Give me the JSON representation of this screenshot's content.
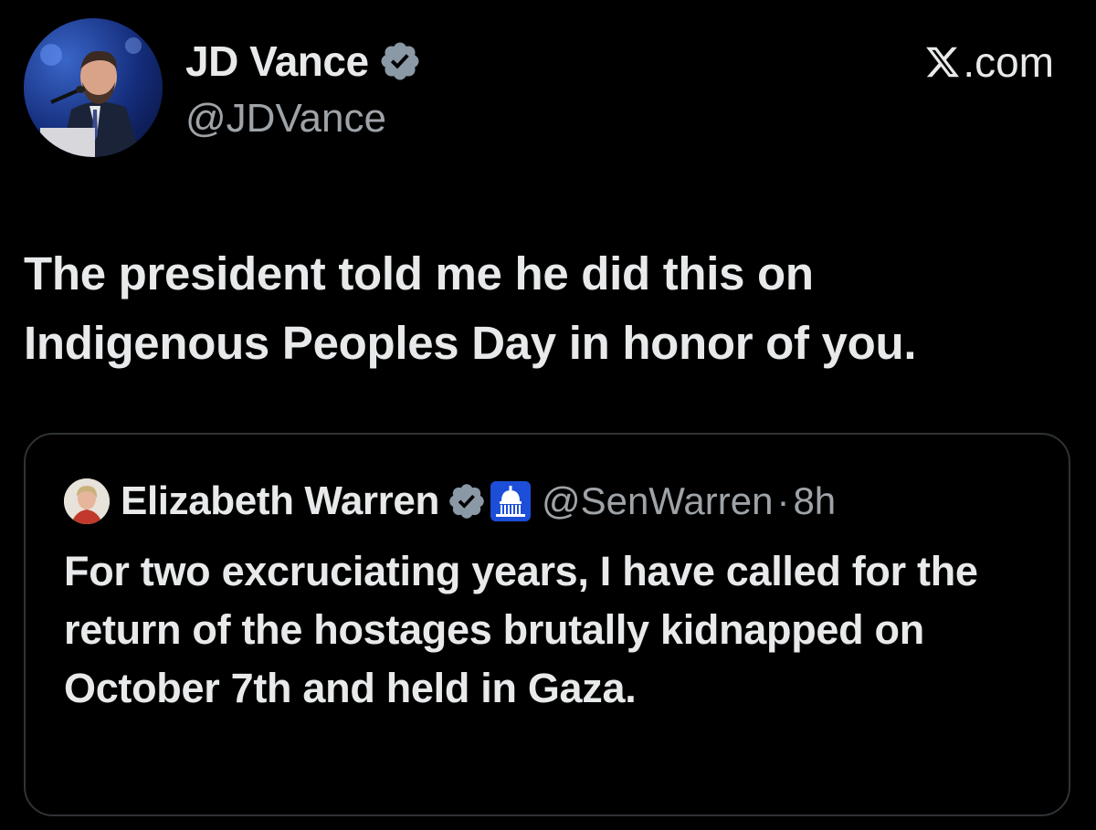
{
  "author": {
    "name": "JD Vance",
    "handle": "@JDVance",
    "verified": true
  },
  "site": {
    "label": ".com",
    "logo": "x-logo-icon"
  },
  "tweet": {
    "text": "The president told me he did this on Indigenous Peoples Day in honor of you."
  },
  "quote": {
    "name": "Elizabeth Warren",
    "handle": "@SenWarren",
    "separator": "·",
    "time": "8h",
    "verified": true,
    "affiliation_badge": "us-capitol-icon",
    "text": "For two excruciating years, I have called for the return of the hostages brutally kidnapped on October 7th and held in Gaza."
  },
  "colors": {
    "background": "#000000",
    "text_primary": "#e7e9ea",
    "text_secondary": "#9ea3a8",
    "verified_gray": "#8b98a5",
    "border": "#2f3336"
  }
}
